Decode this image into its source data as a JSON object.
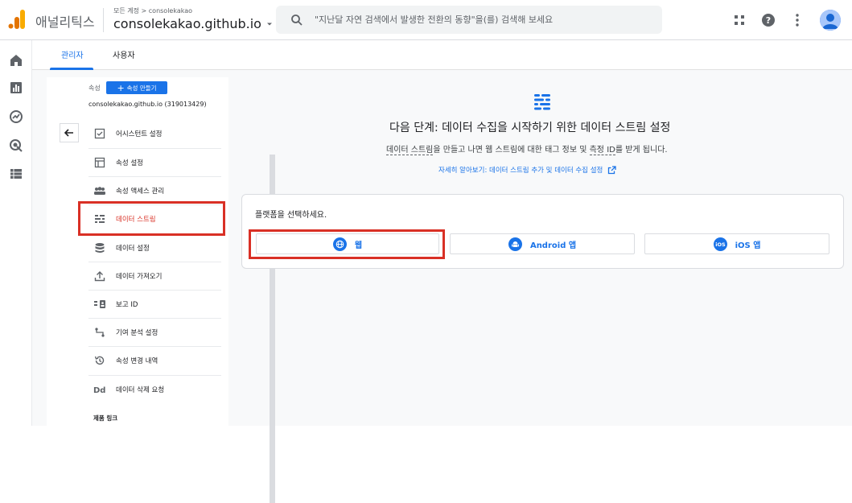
{
  "topbar": {
    "product_name": "애널리틱스",
    "breadcrumb": "모든 계정 > consolekakao",
    "account_name": "consolekakao.github.io",
    "search_placeholder": "\"지난달 자연 검색에서 발생한 전환의 동향\"을(를) 검색해 보세요",
    "icons": [
      "apps-icon",
      "help-icon",
      "more-vert-icon",
      "avatar"
    ]
  },
  "leftnav": {
    "icons": [
      "home-icon",
      "reports-icon",
      "explore-icon",
      "advertising-icon",
      "list-icon"
    ]
  },
  "tabs": [
    {
      "label": "관리자",
      "active": true
    },
    {
      "label": "사용자",
      "active": false
    }
  ],
  "property_panel": {
    "property_label": "속성",
    "create_button": "속성 만들기",
    "property_name": "consolekakao.github.io (319013429)",
    "items": [
      {
        "label": "어시스턴트 설정",
        "icon": "checklist-icon"
      },
      {
        "label": "속성 설정",
        "icon": "layout-icon"
      },
      {
        "label": "속성 액세스 관리",
        "icon": "people-icon"
      },
      {
        "label": "데이터 스트림",
        "icon": "streams-icon",
        "active": true
      },
      {
        "label": "데이터 설정",
        "icon": "database-icon"
      },
      {
        "label": "데이터 가져오기",
        "icon": "upload-icon"
      },
      {
        "label": "보고 ID",
        "icon": "id-icon"
      },
      {
        "label": "기여 분석 설정",
        "icon": "attribution-icon"
      },
      {
        "label": "속성 변경 내역",
        "icon": "history-icon"
      },
      {
        "label": "데이터 삭제 요청",
        "icon": "dd-icon"
      }
    ],
    "section_title": "제품 링크"
  },
  "main": {
    "title": "다음 단계: 데이터 수집을 시작하기 위한 데이터 스트림 설정",
    "subtitle_prefix": "데이터 스트림",
    "subtitle_mid": "을 만들고 나면 웹 스트림에 대한 태그 정보 및 ",
    "subtitle_dashed2": "측정 ID",
    "subtitle_suffix": "를 받게 됩니다.",
    "link": "자세히 알아보기: 데이터 스트림 추가 및 데이터 수집 설정",
    "platform_prompt": "플랫폼을 선택하세요.",
    "platforms": [
      {
        "label": "웹",
        "icon": "globe-icon"
      },
      {
        "label": "Android 앱",
        "icon": "android-icon"
      },
      {
        "label": "iOS 앱",
        "icon": "ios-icon"
      }
    ]
  },
  "colors": {
    "accent": "#1a73e8",
    "highlight": "#d93025",
    "logo_orange": "#f9ab00",
    "logo_dark_orange": "#e37400"
  }
}
